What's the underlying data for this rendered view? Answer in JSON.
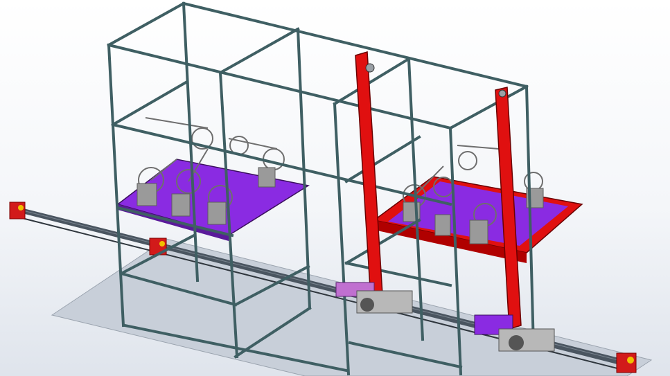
{
  "scene": {
    "subject": "bicycle-parking-rack-assembly",
    "colors": {
      "background_top": "#ffffff",
      "background_bottom": "#dfe4ec",
      "frame": "#3f5f63",
      "frame_highlight": "#6f8f93",
      "lift_column": "#e01010",
      "platform_deck": "#8a2be2",
      "carrier_tray": "#e01010",
      "floor_plate": "#c8cfd9",
      "rail": "#4a5560",
      "drive_motor": "#8a2be2",
      "gearbox": "#b0b0b0",
      "bike": "#707070"
    }
  }
}
